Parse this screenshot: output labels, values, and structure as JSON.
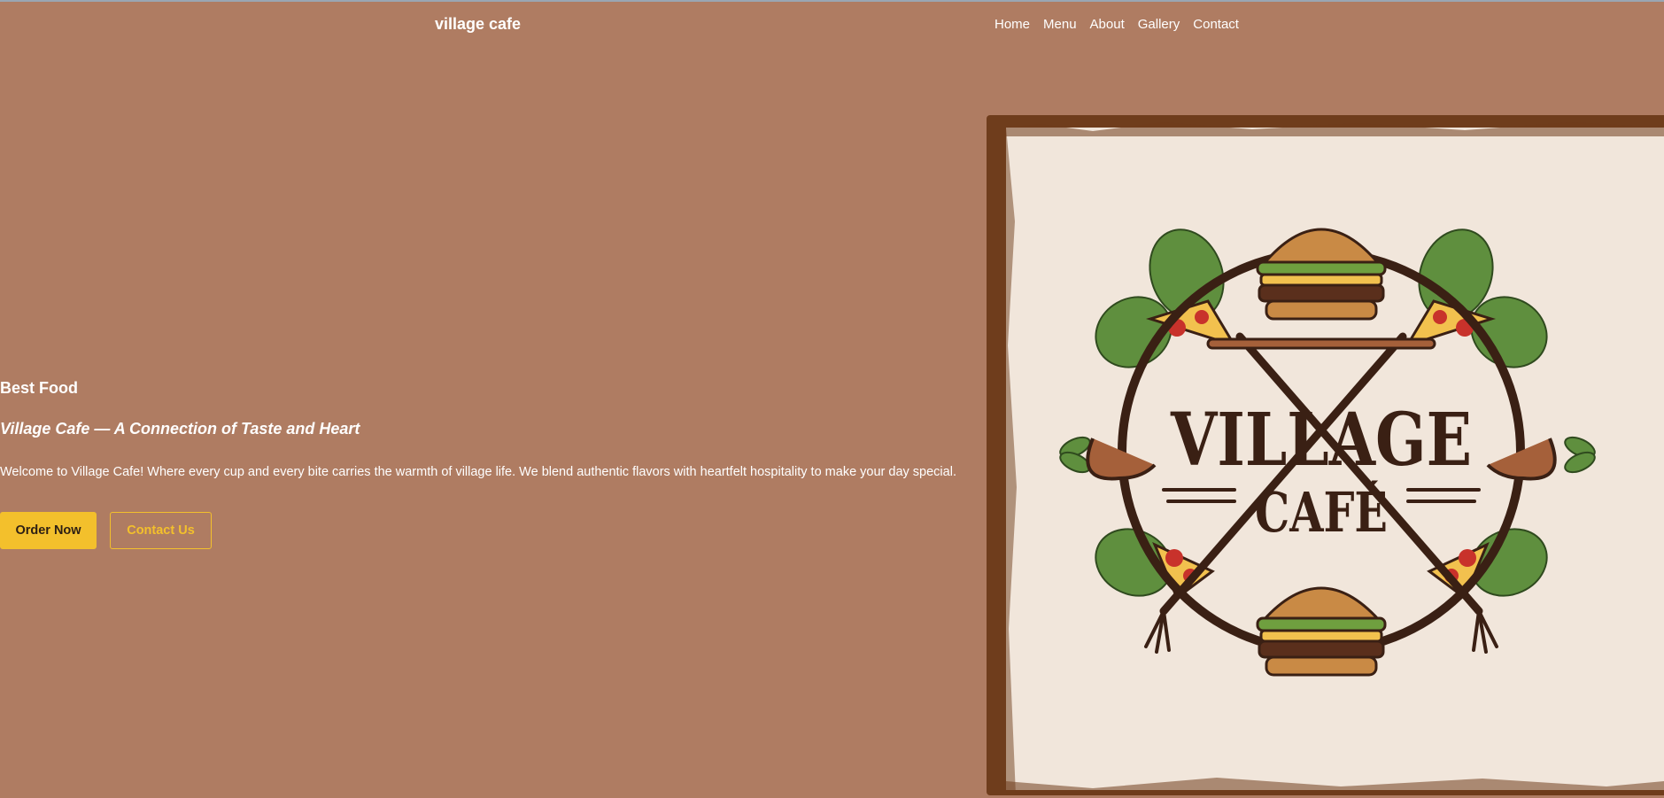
{
  "header": {
    "brand": "village cafe",
    "nav": [
      "Home",
      "Menu",
      "About",
      "Gallery",
      "Contact"
    ]
  },
  "hero": {
    "eyebrow": "Best Food",
    "tagline": "Village Cafe — A Connection of Taste and Heart",
    "intro": "Welcome to Village Cafe! Where every cup and every bite carries the warmth of village life. We blend authentic flavors with heartfelt hospitality to make your day special.",
    "primary_button": "Order Now",
    "secondary_button": "Contact Us"
  },
  "logo": {
    "word_top": "VILLAGE",
    "word_bottom": "CAFÉ"
  },
  "colors": {
    "page_background": "#af7c62",
    "accent": "#f3c02c",
    "frame": "#6f3d1c",
    "logo_background": "#f1e6db",
    "logo_ink": "#3a2014"
  }
}
